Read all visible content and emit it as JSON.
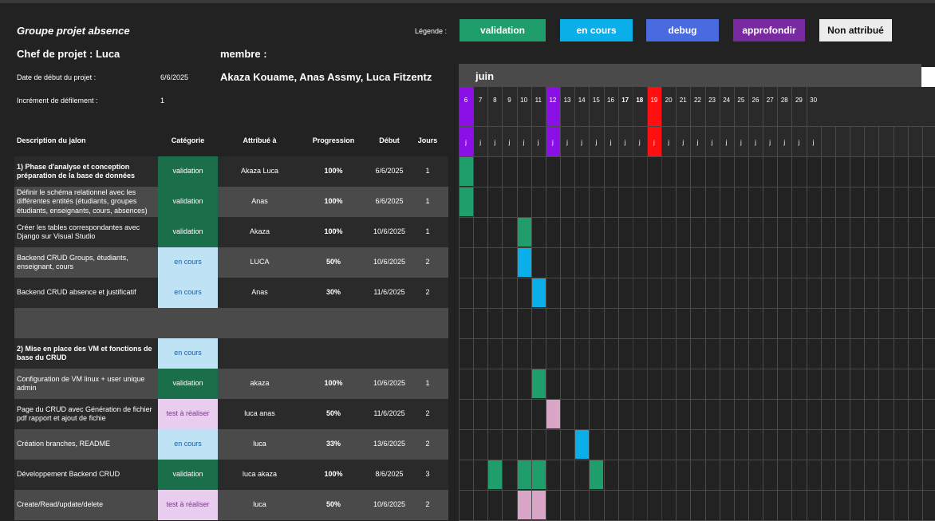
{
  "project": {
    "title": "Groupe projet absence",
    "chef_label": "Chef de projet : Luca",
    "membre_label": "membre :",
    "members": "Akaza Kouame, Anas Assmy, Luca Fitzentz",
    "start_label": "Date de début du projet :",
    "start_value": "6/6/2025",
    "increment_label": "Incrément de défilement :",
    "increment_value": "1"
  },
  "legend": {
    "label": "Légende :",
    "items": [
      {
        "label": "validation",
        "color": "#1f9e6b"
      },
      {
        "label": "en cours",
        "color": "#0aaee8"
      },
      {
        "label": "debug",
        "color": "#4a6be0"
      },
      {
        "label": "approfondir",
        "color": "#7a2aa0"
      },
      {
        "label": "Non attribué",
        "color": "#ececec"
      }
    ]
  },
  "table": {
    "headers": {
      "desc": "Description du jalon",
      "cat": "Catégorie",
      "who": "Attribué à",
      "prog": "Progression",
      "start": "Début",
      "days": "Jours"
    },
    "rows": [
      {
        "desc": "1) Phase d'analyse et conception préparation de la base de données",
        "bold": true,
        "cat": "validation",
        "who": "Akaza Luca",
        "prog": "100%",
        "start": "6/6/2025",
        "days": "1"
      },
      {
        "desc": "Définir le schéma relationnel avec les différentes entités (étudiants, groupes étudiants, enseignants, cours, absences)",
        "cat": "validation",
        "who": "Anas",
        "prog": "100%",
        "start": "6/6/2025",
        "days": "1"
      },
      {
        "desc": "Créer les tables correspondantes avec Django sur Visual Studio",
        "cat": "validation",
        "who": "Akaza",
        "prog": "100%",
        "start": "10/6/2025",
        "days": "1"
      },
      {
        "desc": "Backend CRUD Groups, étudiants, enseignant, cours",
        "cat": "en cours",
        "who": "LUCA",
        "prog": "50%",
        "start": "10/6/2025",
        "days": "2"
      },
      {
        "desc": "Backend CRUD absence et justificatif",
        "cat": "en cours",
        "who": "Anas",
        "prog": "30%",
        "start": "11/6/2025",
        "days": "2"
      },
      {
        "desc": "",
        "cat": "",
        "who": "",
        "prog": "",
        "start": "",
        "days": ""
      },
      {
        "desc": "2) Mise en place des VM et fonctions de base du CRUD",
        "bold": true,
        "cat": "en cours",
        "who": "",
        "prog": "",
        "start": "",
        "days": ""
      },
      {
        "desc": "Configuration de VM linux + user unique admin",
        "cat": "validation",
        "who": "akaza",
        "prog": "100%",
        "start": "10/6/2025",
        "days": "1"
      },
      {
        "desc": "Page du CRUD avec Génération de fichier pdf rapport et ajout de fichie",
        "cat": "test à réaliser",
        "who": "luca anas",
        "prog": "50%",
        "start": "11/6/2025",
        "days": "2"
      },
      {
        "desc": "Création branches, README",
        "cat": "en cours",
        "who": "luca",
        "prog": "33%",
        "start": "13/6/2025",
        "days": "2"
      },
      {
        "desc": "Développement Backend CRUD",
        "cat": "validation",
        "who": "luca akaza",
        "prog": "100%",
        "start": "8/6/2025",
        "days": "3"
      },
      {
        "desc": "Create/Read/update/delete",
        "cat": "test à réaliser",
        "who": "luca",
        "prog": "50%",
        "start": "10/6/2025",
        "days": "2"
      }
    ]
  },
  "category_colors": {
    "validation": "#1a6e4a",
    "en cours": "#bfe2f4",
    "test à réaliser": "#e8cdee"
  },
  "gantt": {
    "month": "juin",
    "days": [
      "6",
      "7",
      "8",
      "9",
      "10",
      "11",
      "12",
      "13",
      "14",
      "15",
      "16",
      "17",
      "18",
      "19",
      "20",
      "21",
      "22",
      "23",
      "24",
      "25",
      "26",
      "27",
      "28",
      "29",
      "30"
    ],
    "day_letter": "j",
    "highlight": {
      "6": "#8b10e8",
      "12": "#8b10e8",
      "19": "#ff1010"
    },
    "bold_days": [
      "17",
      "18"
    ],
    "bars": [
      {
        "row": 0,
        "days": [
          "6"
        ],
        "color": "#1f9e6b"
      },
      {
        "row": 1,
        "days": [
          "6"
        ],
        "color": "#1f9e6b"
      },
      {
        "row": 2,
        "days": [
          "10"
        ],
        "color": "#1f9e6b"
      },
      {
        "row": 3,
        "days": [
          "10"
        ],
        "color": "#0aaee8"
      },
      {
        "row": 4,
        "days": [
          "11"
        ],
        "color": "#0aaee8"
      },
      {
        "row": 7,
        "days": [
          "11"
        ],
        "color": "#1f9e6b"
      },
      {
        "row": 8,
        "days": [
          "12"
        ],
        "color": "#d9a6c8"
      },
      {
        "row": 9,
        "days": [
          "14"
        ],
        "color": "#0aaee8"
      },
      {
        "row": 10,
        "days": [
          "8",
          "10",
          "11",
          "15"
        ],
        "color": "#1f9e6b"
      },
      {
        "row": 11,
        "days": [
          "10",
          "11"
        ],
        "color": "#d9a6c8"
      }
    ]
  }
}
